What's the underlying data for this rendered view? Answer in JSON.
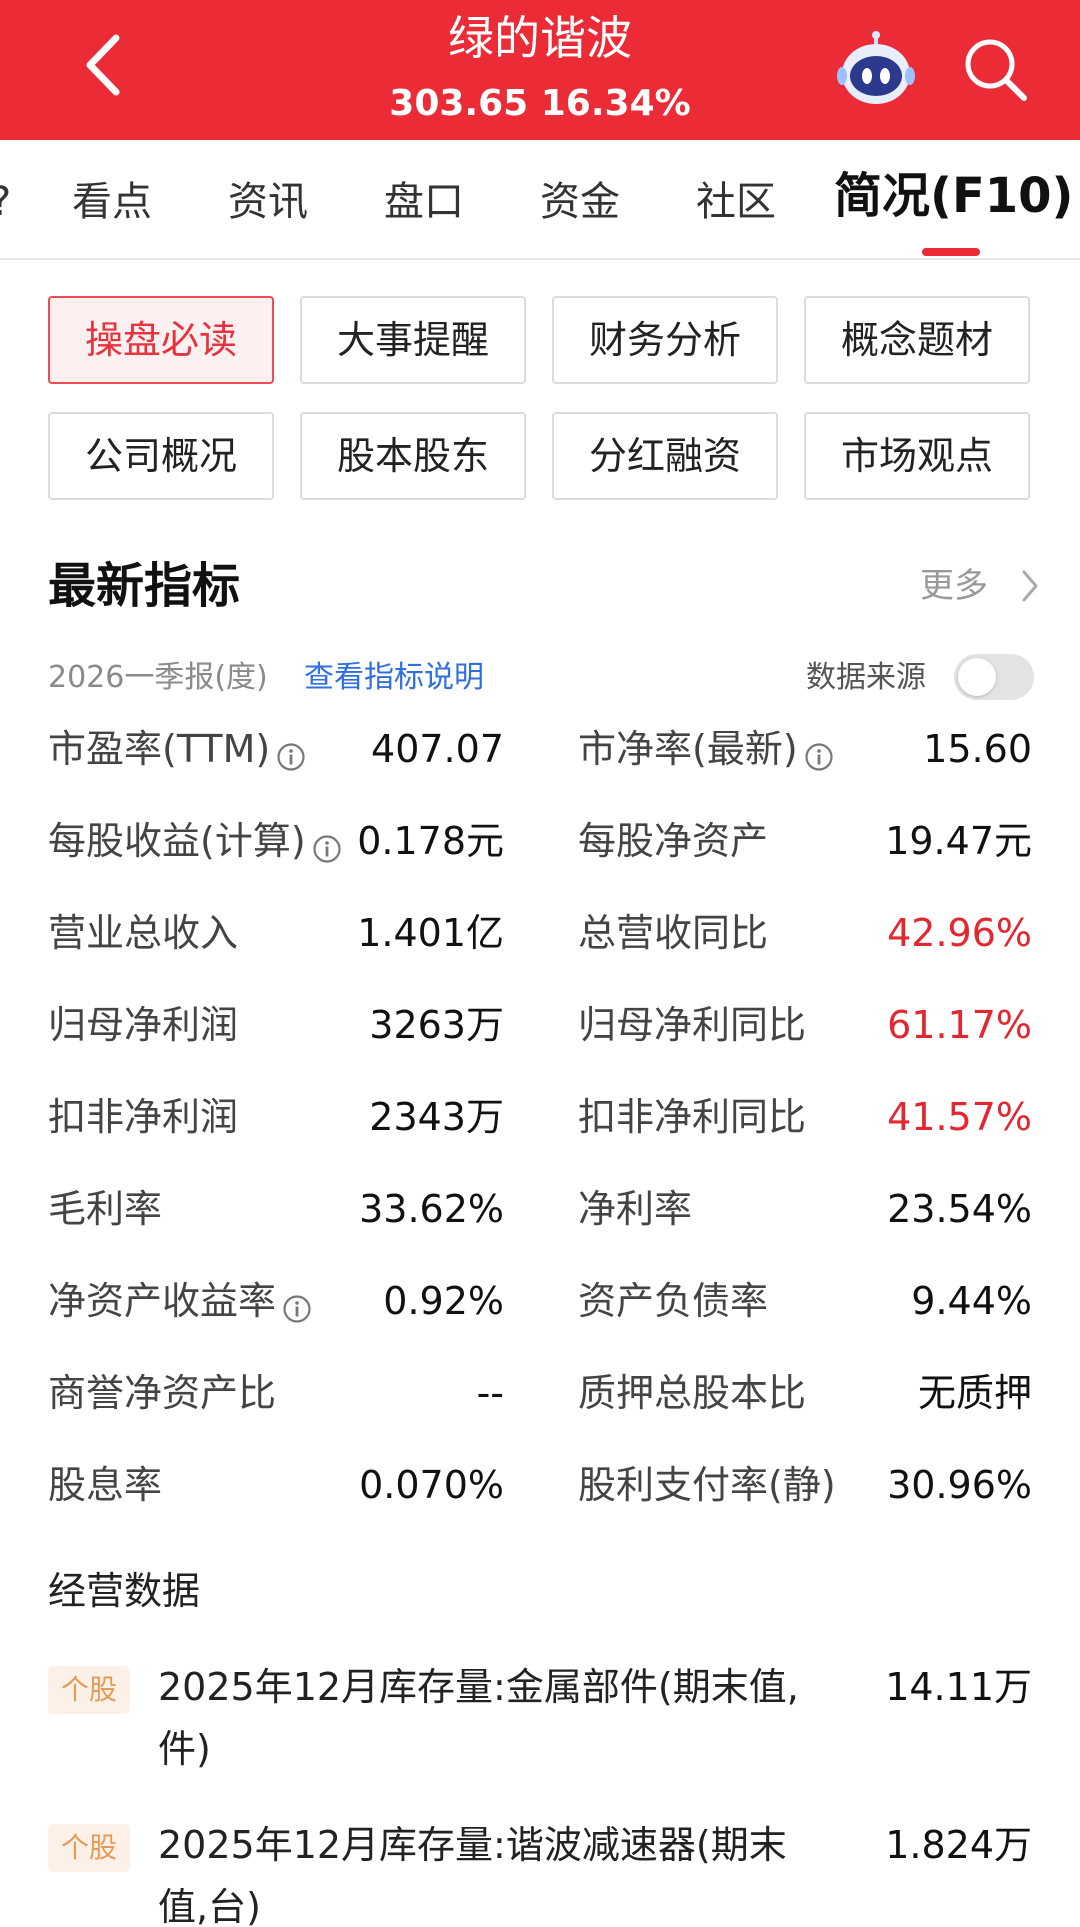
{
  "header": {
    "stock_name": "绿的谐波",
    "price": "303.65",
    "change_pct": "16.34%",
    "bg_color": "#eb2b36"
  },
  "tabs": {
    "cut_left": "?",
    "items": [
      "看点",
      "资讯",
      "盘口",
      "资金",
      "社区",
      "简况(F10)"
    ],
    "active": "简况(F10)",
    "accent": "#eb2b36"
  },
  "chips": [
    "操盘必读",
    "大事提醒",
    "财务分析",
    "概念题材",
    "公司概况",
    "股本股东",
    "分红融资",
    "市场观点"
  ],
  "chip_active": "操盘必读",
  "latest": {
    "title": "最新指标",
    "more": "更多",
    "period": "2026一季报(度)",
    "explain_link": "查看指标说明",
    "source_label": "数据来源"
  },
  "metrics": [
    {
      "left_label": "市盈率(TTM)",
      "left_info": true,
      "left_value": "407.07",
      "right_label": "市净率(最新)",
      "right_info": true,
      "right_value": "15.60",
      "right_up": false
    },
    {
      "left_label": "每股收益(计算)",
      "left_info": true,
      "left_value": "0.178元",
      "right_label": "每股净资产",
      "right_info": false,
      "right_value": "19.47元",
      "right_up": false
    },
    {
      "left_label": "营业总收入",
      "left_info": false,
      "left_value": "1.401亿",
      "right_label": "总营收同比",
      "right_info": false,
      "right_value": "42.96%",
      "right_up": true
    },
    {
      "left_label": "归母净利润",
      "left_info": false,
      "left_value": "3263万",
      "right_label": "归母净利同比",
      "right_info": false,
      "right_value": "61.17%",
      "right_up": true
    },
    {
      "left_label": "扣非净利润",
      "left_info": false,
      "left_value": "2343万",
      "right_label": "扣非净利同比",
      "right_info": false,
      "right_value": "41.57%",
      "right_up": true
    },
    {
      "left_label": "毛利率",
      "left_info": false,
      "left_value": "33.62%",
      "right_label": "净利率",
      "right_info": false,
      "right_value": "23.54%",
      "right_up": false
    },
    {
      "left_label": "净资产收益率",
      "left_info": true,
      "left_value": "0.92%",
      "right_label": "资产负债率",
      "right_info": false,
      "right_value": "9.44%",
      "right_up": false
    },
    {
      "left_label": "商誉净资产比",
      "left_info": false,
      "left_value": "--",
      "right_label": "质押总股本比",
      "right_info": false,
      "right_value": "无质押",
      "right_up": false
    },
    {
      "left_label": "股息率",
      "left_info": false,
      "left_value": "0.070%",
      "right_label": "股利支付率(静)",
      "right_info": false,
      "right_value": "30.96%",
      "right_up": false
    }
  ],
  "business": {
    "title": "经营数据",
    "items": [
      {
        "tag": "个股",
        "text": "2025年12月库存量:金属部件(期末值,件)",
        "value": "14.11万"
      },
      {
        "tag": "个股",
        "text": "2025年12月库存量:谐波减速器(期末值,台)",
        "value": "1.824万"
      }
    ]
  }
}
